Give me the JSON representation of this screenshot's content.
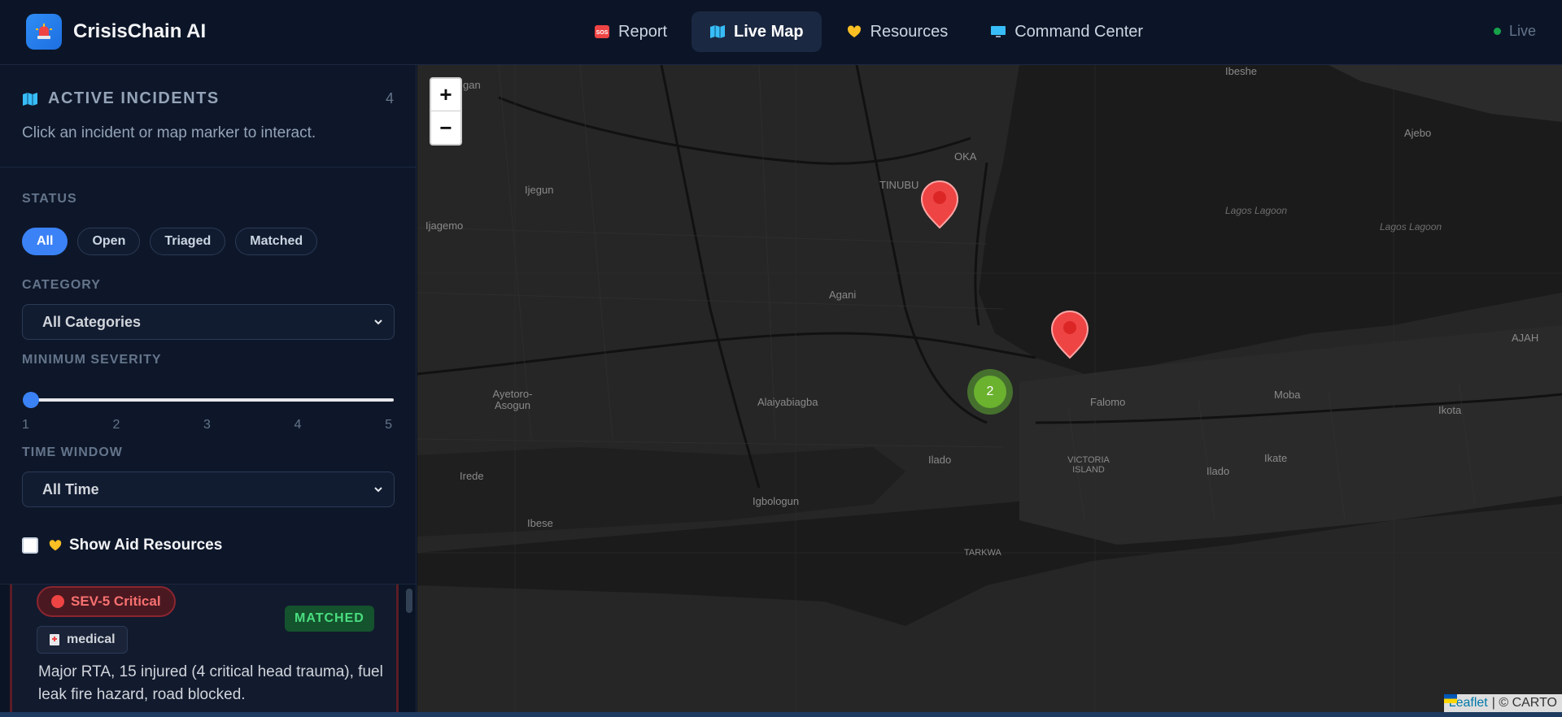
{
  "app": {
    "name": "CrisisChain AI",
    "status": "Live"
  },
  "nav": [
    {
      "label": "Report",
      "icon": "sos-icon"
    },
    {
      "label": "Live Map",
      "icon": "map-icon",
      "active": true
    },
    {
      "label": "Resources",
      "icon": "heart-hand-icon"
    },
    {
      "label": "Command Center",
      "icon": "computer-icon"
    }
  ],
  "sidebar": {
    "title": "ACTIVE INCIDENTS",
    "count": "4",
    "subtitle": "Click an incident or map marker to interact.",
    "status_label": "STATUS",
    "status_chips": [
      "All",
      "Open",
      "Triaged",
      "Matched"
    ],
    "status_selected": "All",
    "category_label": "CATEGORY",
    "category_value": "All Categories",
    "severity_label": "MINIMUM SEVERITY",
    "severity_value": 1,
    "severity_ticks": [
      "1",
      "2",
      "3",
      "4",
      "5"
    ],
    "time_label": "TIME WINDOW",
    "time_value": "All Time",
    "show_resources_label": "Show Aid Resources",
    "show_resources_checked": false
  },
  "incident": {
    "severity": "SEV-5 Critical",
    "category": "medical",
    "status": "MATCHED",
    "description": "Major RTA, 15 injured (4 critical head trauma), fuel leak fire hazard, road blocked."
  },
  "map": {
    "zoom_in": "+",
    "zoom_out": "−",
    "cluster_count": "2",
    "attribution_link": "Leaflet",
    "attribution_text": "| © CARTO",
    "places": [
      "Ibeshe",
      "Ajebo",
      "Lagos Lagoon",
      "Lagos Lagoon",
      "AJAH",
      "Ijegun",
      "Ijagemo",
      "TINUBU",
      "OKA",
      "Agani",
      "Ayetoro-Asogun",
      "Alaiyabiagba",
      "Falomo",
      "Moba",
      "Ikota",
      "Ilado",
      "VICTORIA ISLAND",
      "Ilado",
      "Ikate",
      "Irede",
      "Igbologun",
      "Ibese",
      "TARKWA",
      "gan"
    ],
    "colors": {
      "marker": "#ef4444",
      "cluster": "#6bb22f",
      "water": "#1b1b1b",
      "land": "#262626"
    }
  }
}
